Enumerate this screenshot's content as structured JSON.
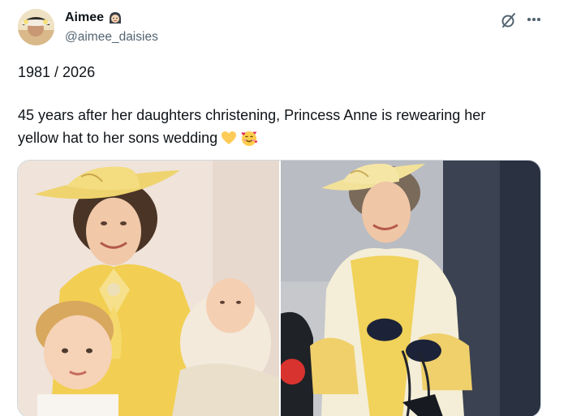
{
  "author": {
    "display_name": "Aimee",
    "handle": "@aimee_daisies",
    "badge_icon": "woman-with-headscarf-emoji",
    "avatar_icon": "profile-photo"
  },
  "tweet": {
    "date_line": "1981 / 2026",
    "body_line_1": "45 years after her daughters christening, Princess Anne is rewearing her",
    "body_line_2": "yellow hat to her sons wedding",
    "emojis": [
      "yellow-heart-emoji",
      "smiling-face-with-hearts-emoji"
    ]
  },
  "header_actions": {
    "grok_icon": "grok-icon",
    "more_icon": "more-options-icon"
  },
  "media": {
    "photo_left": "photo-1981-christening",
    "photo_right": "photo-2026-wedding",
    "colors": {
      "hat_yellow": "#f2dc78",
      "dress_yellow": "#f4d55a",
      "shawl_cream": "#f6f0dc"
    }
  },
  "colors": {
    "text_primary": "#0f1419",
    "text_secondary": "#536471",
    "border": "#cfd9de"
  }
}
